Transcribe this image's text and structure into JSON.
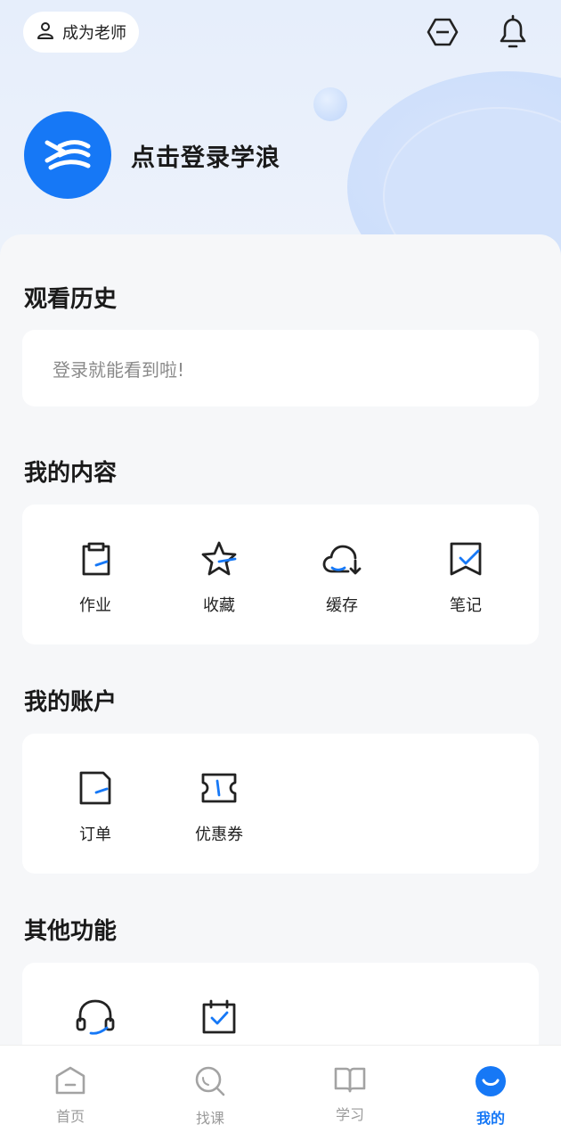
{
  "header": {
    "become_teacher": "成为老师",
    "login_prompt": "点击登录学浪"
  },
  "history": {
    "title": "观看历史",
    "empty_text": "登录就能看到啦!"
  },
  "my_content": {
    "title": "我的内容",
    "items": [
      {
        "label": "作业",
        "icon": "clipboard-icon"
      },
      {
        "label": "收藏",
        "icon": "star-icon"
      },
      {
        "label": "缓存",
        "icon": "cloud-download-icon"
      },
      {
        "label": "笔记",
        "icon": "note-check-icon"
      }
    ]
  },
  "my_account": {
    "title": "我的账户",
    "items": [
      {
        "label": "订单",
        "icon": "order-icon"
      },
      {
        "label": "优惠券",
        "icon": "coupon-icon"
      }
    ]
  },
  "other": {
    "title": "其他功能",
    "items": [
      {
        "label": "",
        "icon": "headset-icon"
      },
      {
        "label": "",
        "icon": "calendar-check-icon"
      }
    ]
  },
  "tabbar": {
    "tabs": [
      {
        "label": "首页",
        "icon": "home-icon"
      },
      {
        "label": "找课",
        "icon": "search-icon"
      },
      {
        "label": "学习",
        "icon": "book-icon"
      },
      {
        "label": "我的",
        "icon": "profile-icon",
        "active": true
      }
    ]
  },
  "colors": {
    "accent": "#1678f6",
    "icon_dark": "#2a2a2a",
    "inactive": "#9a9a9a"
  }
}
